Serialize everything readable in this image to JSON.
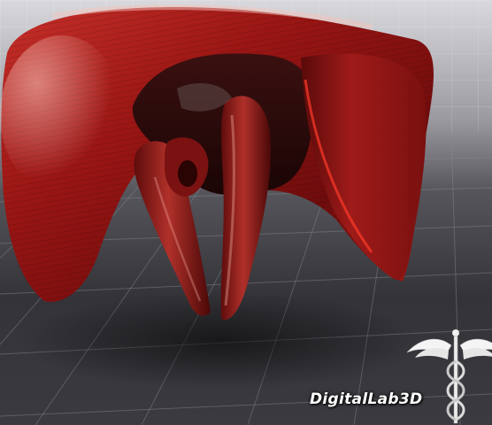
{
  "image": {
    "subject": "3d-render",
    "colors": {
      "background_light": "#d4d4d8",
      "floor_dark": "#2b2b30",
      "muscle_red": "#b01e1c",
      "muscle_dark": "#4a0808"
    }
  },
  "watermark": {
    "text": "DigitalLab3D",
    "logo_icon": "caduceus-icon"
  }
}
